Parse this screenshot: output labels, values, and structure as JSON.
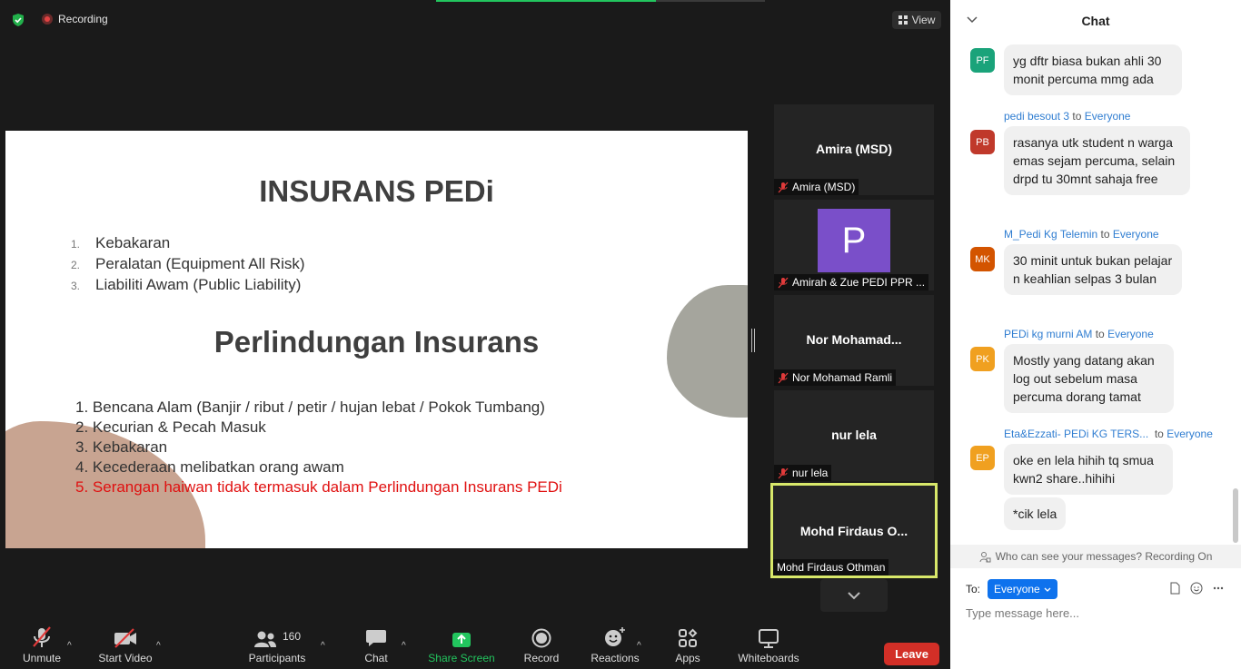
{
  "meeting": {
    "recording_label": "Recording",
    "view_label": "View"
  },
  "slide": {
    "title": "INSURANS PEDi",
    "items": [
      {
        "num": "1.",
        "text": "Kebakaran"
      },
      {
        "num": "2.",
        "text": "Peralatan (Equipment All Risk)"
      },
      {
        "num": "3.",
        "text": "Liabiliti Awam (Public Liability)"
      }
    ],
    "subtitle": "Perlindungan Insurans",
    "protections": [
      "1. Bencana  Alam (Banjir / ribut /  petir / hujan lebat / Pokok Tumbang)",
      "2. Kecurian & Pecah Masuk",
      "3. Kebakaran",
      "4. Kecederaan melibatkan orang awam"
    ],
    "exclusion": "5. Serangan haiwan tidak termasuk dalam Perlindungan Insurans PEDi"
  },
  "participants": [
    {
      "name": "Amira (MSD)",
      "label": "Amira (MSD)",
      "muted": true
    },
    {
      "name": "P",
      "label": "Amirah & Zue PEDI PPR ...",
      "muted": true,
      "avatar_color": "#7a4fc9"
    },
    {
      "name": "Nor  Mohamad...",
      "label": "Nor Mohamad Ramli",
      "muted": true
    },
    {
      "name": "nur lela",
      "label": "nur lela",
      "muted": true
    },
    {
      "name": "Mohd  Firdaus  O...",
      "label": "Mohd Firdaus Othman",
      "muted": false,
      "active": true
    }
  ],
  "toolbar": {
    "unmute": "Unmute",
    "start_video": "Start Video",
    "participants": "Participants",
    "participants_count": "160",
    "chat": "Chat",
    "share_screen": "Share Screen",
    "record": "Record",
    "reactions": "Reactions",
    "apps": "Apps",
    "whiteboards": "Whiteboards",
    "leave": "Leave"
  },
  "chat": {
    "title": "Chat",
    "messages": [
      {
        "initials": "PF",
        "color": "#1aa37a",
        "sender": "",
        "to": "",
        "recipient": "",
        "text": "yg dftr biasa bukan ahli 30 monit percuma mmg ada"
      },
      {
        "initials": "PB",
        "color": "#c0392b",
        "sender": "pedi besout 3",
        "to": "to",
        "recipient": "Everyone",
        "text": "rasanya utk student n warga emas sejam percuma, selain drpd tu 30mnt sahaja free"
      },
      {
        "initials": "MK",
        "color": "#d35400",
        "sender": "M_Pedi Kg Telemin",
        "to": "to",
        "recipient": "Everyone",
        "text": "30 minit untuk bukan pelajar n keahlian selpas 3 bulan"
      },
      {
        "initials": "PK",
        "color": "#f0a020",
        "sender": "PEDi kg murni AM",
        "to": "to",
        "recipient": "Everyone",
        "text": "Mostly yang datang akan log out sebelum masa percuma dorang tamat"
      },
      {
        "initials": "EP",
        "color": "#f0a020",
        "sender": "Eta&Ezzati- PEDi KG TERS...",
        "to": "to",
        "recipient": "Everyone",
        "text": "oke en lela hihih tq smua kwn2 share..hihihi",
        "extra": "*cik lela"
      }
    ],
    "privacy_note": "Who can see your messages? Recording On",
    "to_label": "To:",
    "recipient_button": "Everyone",
    "input_placeholder": "Type message here..."
  }
}
